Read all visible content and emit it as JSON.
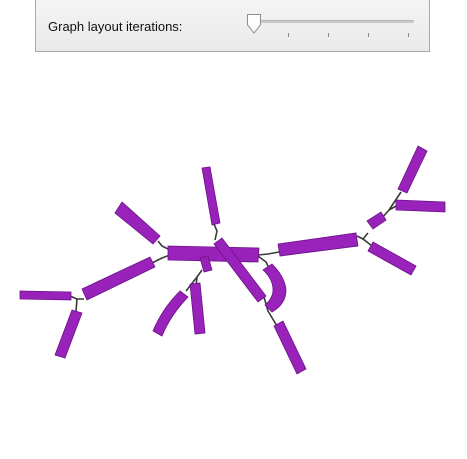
{
  "controls": {
    "iterations_label": "Graph layout iterations:",
    "iterations_value": 0,
    "iterations_min": 0,
    "iterations_max": 100,
    "iterations_tick_count": 5
  },
  "graph": {
    "edge_color": "#3a3a3a",
    "node_fill": "#9922bb",
    "node_stroke": "#6a1288"
  }
}
